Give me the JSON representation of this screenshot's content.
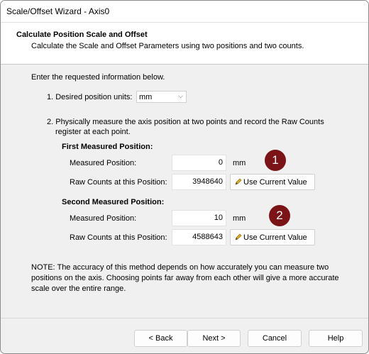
{
  "window": {
    "title": "Scale/Offset Wizard - Axis0"
  },
  "header": {
    "title": "Calculate Position Scale and Offset",
    "subtitle": "Calculate the Scale and Offset Parameters using two positions and two counts."
  },
  "intro": "Enter the requested information below.",
  "step1": {
    "label": "1. Desired position units:",
    "units_value": "mm"
  },
  "step2": {
    "line1": "2. Physically measure the axis position at two points and record the Raw Counts",
    "line2": "register at each point."
  },
  "first": {
    "heading": "First Measured Position:",
    "measured_label": "Measured Position:",
    "measured_value": "0",
    "unit": "mm",
    "raw_label": "Raw Counts at this Position:",
    "raw_value": "3948640",
    "use_button": "Use Current Value",
    "marker": "1"
  },
  "second": {
    "heading": "Second Measured Position:",
    "measured_label": "Measured Position:",
    "measured_value": "10",
    "unit": "mm",
    "raw_label": "Raw Counts at this Position:",
    "raw_value": "4588643",
    "use_button": "Use Current Value",
    "marker": "2"
  },
  "note": "NOTE: The accuracy of this method depends on how accurately you can measure two positions on the axis. Choosing points far away from each other will give a more accurate scale over the entire range.",
  "buttons": {
    "back": "< Back",
    "next": "Next >",
    "cancel": "Cancel",
    "help": "Help"
  },
  "colors": {
    "marker": "#7a1416",
    "pencil": "#e0b020"
  },
  "icons": {
    "dropdown": "chevron-down-icon",
    "use_value": "pencil-icon"
  }
}
